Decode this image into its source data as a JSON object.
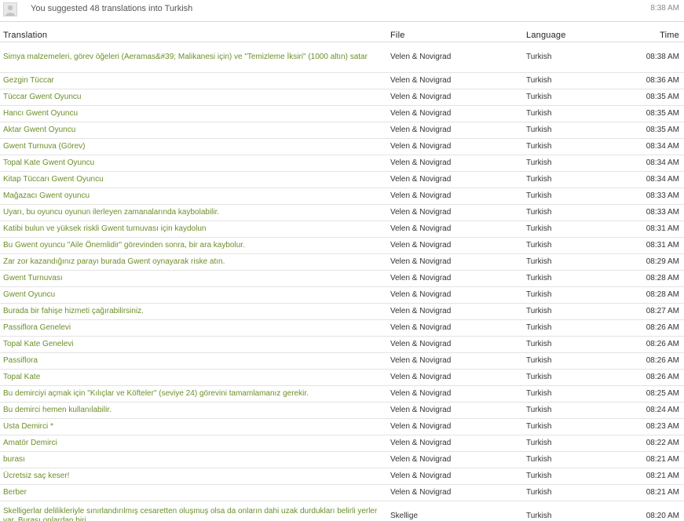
{
  "header": {
    "message": "You suggested 48 translations into Turkish",
    "time": "8:38 AM"
  },
  "table": {
    "columns": {
      "translation": "Translation",
      "file": "File",
      "language": "Language",
      "time": "Time"
    },
    "rows": [
      {
        "translation": "Simya malzemeleri, görev öğeleri (Aeramas&#39; Malikanesi için) ve \"Temizleme İksiri\" (1000 altın) satar",
        "file": "Velen & Novigrad",
        "language": "Turkish",
        "time": "08:38 AM"
      },
      {
        "translation": "Gezgin Tüccar",
        "file": "Velen & Novigrad",
        "language": "Turkish",
        "time": "08:36 AM"
      },
      {
        "translation": "Tüccar Gwent Oyuncu",
        "file": "Velen & Novigrad",
        "language": "Turkish",
        "time": "08:35 AM"
      },
      {
        "translation": "Hancı Gwent Oyuncu",
        "file": "Velen & Novigrad",
        "language": "Turkish",
        "time": "08:35 AM"
      },
      {
        "translation": "Aktar Gwent Oyuncu",
        "file": "Velen & Novigrad",
        "language": "Turkish",
        "time": "08:35 AM"
      },
      {
        "translation": "Gwent Turnuva (Görev)",
        "file": "Velen & Novigrad",
        "language": "Turkish",
        "time": "08:34 AM"
      },
      {
        "translation": "Topal Kate Gwent Oyuncu",
        "file": "Velen & Novigrad",
        "language": "Turkish",
        "time": "08:34 AM"
      },
      {
        "translation": "Kitap Tüccarı Gwent Oyuncu",
        "file": "Velen & Novigrad",
        "language": "Turkish",
        "time": "08:34 AM"
      },
      {
        "translation": "Mağazacı Gwent oyuncu",
        "file": "Velen & Novigrad",
        "language": "Turkish",
        "time": "08:33 AM"
      },
      {
        "translation": "Uyarı, bu oyuncu oyunun ilerleyen zamanalarında kaybolabilir.",
        "file": "Velen & Novigrad",
        "language": "Turkish",
        "time": "08:33 AM"
      },
      {
        "translation": "Katibi bulun ve yüksek riskli Gwent turnuvası için kaydolun",
        "file": "Velen & Novigrad",
        "language": "Turkish",
        "time": "08:31 AM"
      },
      {
        "translation": "Bu Gwent oyuncu \"Aile Önemlidir\" görevinden sonra, bir ara kaybolur.",
        "file": "Velen & Novigrad",
        "language": "Turkish",
        "time": "08:31 AM"
      },
      {
        "translation": "Zar zor kazandığınız parayı burada Gwent oynayarak riske atın.",
        "file": "Velen & Novigrad",
        "language": "Turkish",
        "time": "08:29 AM"
      },
      {
        "translation": "Gwent Turnuvası",
        "file": "Velen & Novigrad",
        "language": "Turkish",
        "time": "08:28 AM"
      },
      {
        "translation": "Gwent Oyuncu",
        "file": "Velen & Novigrad",
        "language": "Turkish",
        "time": "08:28 AM"
      },
      {
        "translation": "Burada bir fahişe hizmeti çağırabilirsiniz.",
        "file": "Velen & Novigrad",
        "language": "Turkish",
        "time": "08:27 AM"
      },
      {
        "translation": "Passiflora Genelevi",
        "file": "Velen & Novigrad",
        "language": "Turkish",
        "time": "08:26 AM"
      },
      {
        "translation": "Topal Kate Genelevi",
        "file": "Velen & Novigrad",
        "language": "Turkish",
        "time": "08:26 AM"
      },
      {
        "translation": "Passiflora",
        "file": "Velen & Novigrad",
        "language": "Turkish",
        "time": "08:26 AM"
      },
      {
        "translation": "Topal Kate",
        "file": "Velen & Novigrad",
        "language": "Turkish",
        "time": "08:26 AM"
      },
      {
        "translation": "Bu demirciyi açmak için \"Kılıçlar ve Köfteler\" (seviye 24) görevini tamamlamanız gerekir.",
        "file": "Velen & Novigrad",
        "language": "Turkish",
        "time": "08:25 AM"
      },
      {
        "translation": "Bu demirci hemen kullanılabilir.",
        "file": "Velen & Novigrad",
        "language": "Turkish",
        "time": "08:24 AM"
      },
      {
        "translation": "Usta Demirci *",
        "file": "Velen & Novigrad",
        "language": "Turkish",
        "time": "08:23 AM"
      },
      {
        "translation": "Amatör Demirci",
        "file": "Velen & Novigrad",
        "language": "Turkish",
        "time": "08:22 AM"
      },
      {
        "translation": "burası",
        "file": "Velen & Novigrad",
        "language": "Turkish",
        "time": "08:21 AM"
      },
      {
        "translation": "Ücretsiz saç keser!",
        "file": "Velen & Novigrad",
        "language": "Turkish",
        "time": "08:21 AM"
      },
      {
        "translation": "Berber",
        "file": "Velen & Novigrad",
        "language": "Turkish",
        "time": "08:21 AM"
      },
      {
        "translation": "Skelligerlar delilikleriyle sınırlandırılmış cesaretten oluşmuş olsa da onların dahi uzak durdukları belirli yerler var. Burası onlardan biri.",
        "file": "Skellige",
        "language": "Turkish",
        "time": "08:20 AM"
      }
    ]
  },
  "colors": {
    "translation_link": "#6d8f2a",
    "border": "#e3e3e3",
    "text": "#333333"
  },
  "icons": {
    "avatar": "user-avatar-icon"
  }
}
